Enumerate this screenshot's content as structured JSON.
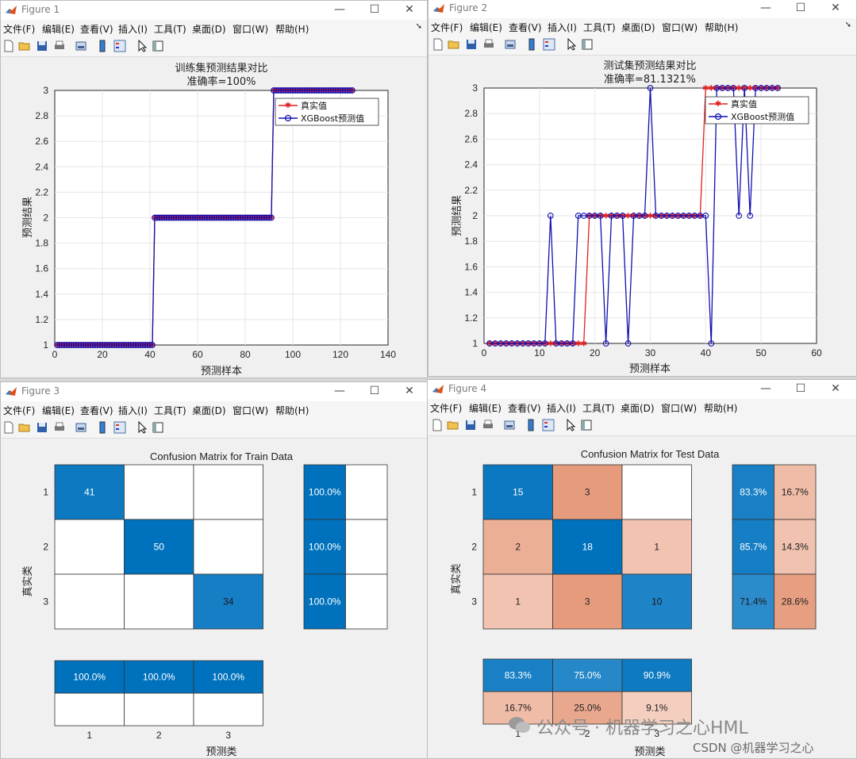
{
  "menu_items": [
    "文件(F)",
    "编辑(E)",
    "查看(V)",
    "插入(I)",
    "工具(T)",
    "桌面(D)",
    "窗口(W)",
    "帮助(H)"
  ],
  "window_controls": {
    "minimize": "—",
    "maximize": "☐",
    "close": "✕"
  },
  "colors": {
    "true_series": "#e02020",
    "pred_series": "#1010b0",
    "dark_blue": "#0072bd",
    "cell_border": "#333333"
  },
  "figures": [
    {
      "title": "Figure 1"
    },
    {
      "title": "Figure 2"
    },
    {
      "title": "Figure 3"
    },
    {
      "title": "Figure 4"
    }
  ],
  "fig1": {
    "title_line1": "训练集预测结果对比",
    "title_line2": "准确率=100%",
    "xlabel": "预测样本",
    "ylabel": "预测结果",
    "legend": [
      "真实值",
      "XGBoost预测值"
    ]
  },
  "fig2": {
    "title_line1": "测试集预测结果对比",
    "title_line2": "准确率=81.1321%",
    "xlabel": "预测样本",
    "ylabel": "预测结果",
    "legend": [
      "真实值",
      "XGBoost预测值"
    ]
  },
  "fig3": {
    "title": "Confusion Matrix for Train Data",
    "xlabel": "预测类",
    "ylabel": "真实类"
  },
  "fig4": {
    "title": "Confusion Matrix for Test Data",
    "xlabel": "预测类",
    "ylabel": "真实类"
  },
  "watermark": {
    "main": "公众号 · 机器学习之心HML",
    "sub": "CSDN @机器学习之心"
  },
  "chart_data": [
    {
      "type": "line",
      "title": "训练集预测结果对比 准确率=100%",
      "xlabel": "预测样本",
      "ylabel": "预测结果",
      "xlim": [
        0,
        140
      ],
      "ylim": [
        1,
        3
      ],
      "xticks": [
        0,
        20,
        40,
        60,
        80,
        100,
        120,
        140
      ],
      "yticks": [
        1,
        1.2,
        1.4,
        1.6,
        1.8,
        2,
        2.2,
        2.4,
        2.6,
        2.8,
        3
      ],
      "grid": true,
      "legend_position": "top-right",
      "series": [
        {
          "name": "真实值",
          "segments": [
            {
              "from": 1,
              "to": 41,
              "value": 1
            },
            {
              "from": 42,
              "to": 91,
              "value": 2
            },
            {
              "from": 92,
              "to": 125,
              "value": 3
            }
          ]
        },
        {
          "name": "XGBoost预测值",
          "segments": [
            {
              "from": 1,
              "to": 41,
              "value": 1
            },
            {
              "from": 42,
              "to": 91,
              "value": 2
            },
            {
              "from": 92,
              "to": 125,
              "value": 3
            }
          ]
        }
      ]
    },
    {
      "type": "line",
      "title": "测试集预测结果对比 准确率=81.1321%",
      "xlabel": "预测样本",
      "ylabel": "预测结果",
      "xlim": [
        0,
        60
      ],
      "ylim": [
        1,
        3
      ],
      "xticks": [
        0,
        10,
        20,
        30,
        40,
        50,
        60
      ],
      "yticks": [
        1,
        1.2,
        1.4,
        1.6,
        1.8,
        2,
        2.2,
        2.4,
        2.6,
        2.8,
        3
      ],
      "grid": true,
      "legend_position": "top-right",
      "x": [
        1,
        2,
        3,
        4,
        5,
        6,
        7,
        8,
        9,
        10,
        11,
        12,
        13,
        14,
        15,
        16,
        17,
        18,
        19,
        20,
        21,
        22,
        23,
        24,
        25,
        26,
        27,
        28,
        29,
        30,
        31,
        32,
        33,
        34,
        35,
        36,
        37,
        38,
        39,
        40,
        41,
        42,
        43,
        44,
        45,
        46,
        47,
        48,
        49,
        50,
        51,
        52,
        53
      ],
      "series": [
        {
          "name": "真实值",
          "values": [
            1,
            1,
            1,
            1,
            1,
            1,
            1,
            1,
            1,
            1,
            1,
            1,
            1,
            1,
            1,
            1,
            1,
            1,
            2,
            2,
            2,
            2,
            2,
            2,
            2,
            2,
            2,
            2,
            2,
            2,
            2,
            2,
            2,
            2,
            2,
            2,
            2,
            2,
            2,
            3,
            3,
            3,
            3,
            3,
            3,
            3,
            3,
            3,
            3,
            3,
            3,
            3,
            3
          ]
        },
        {
          "name": "XGBoost预测值",
          "values": [
            1,
            1,
            1,
            1,
            1,
            1,
            1,
            1,
            1,
            1,
            1,
            2,
            1,
            1,
            1,
            1,
            2,
            2,
            2,
            2,
            2,
            1,
            2,
            2,
            2,
            1,
            2,
            2,
            2,
            3,
            2,
            2,
            2,
            2,
            2,
            2,
            2,
            2,
            2,
            2,
            1,
            3,
            3,
            3,
            3,
            2,
            3,
            2,
            3,
            3,
            3,
            3,
            3
          ]
        }
      ]
    },
    {
      "type": "heatmap",
      "title": "Confusion Matrix for Train Data",
      "xlabel": "预测类",
      "ylabel": "真实类",
      "classes": [
        "1",
        "2",
        "3"
      ],
      "matrix": [
        [
          41,
          null,
          null
        ],
        [
          null,
          50,
          null
        ],
        [
          null,
          null,
          34
        ]
      ],
      "row_summary": [
        [
          "100.0%",
          ""
        ],
        [
          "100.0%",
          ""
        ],
        [
          "100.0%",
          ""
        ]
      ],
      "column_summary": [
        [
          "100.0%",
          "100.0%",
          "100.0%"
        ],
        [
          "",
          "",
          ""
        ]
      ]
    },
    {
      "type": "heatmap",
      "title": "Confusion Matrix for Test Data",
      "xlabel": "预测类",
      "ylabel": "真实类",
      "classes": [
        "1",
        "2",
        "3"
      ],
      "matrix": [
        [
          15,
          3,
          null
        ],
        [
          2,
          18,
          1
        ],
        [
          1,
          3,
          10
        ]
      ],
      "row_summary": [
        [
          "83.3%",
          "16.7%"
        ],
        [
          "85.7%",
          "14.3%"
        ],
        [
          "71.4%",
          "28.6%"
        ]
      ],
      "column_summary": [
        [
          "83.3%",
          "75.0%",
          "90.9%"
        ],
        [
          "16.7%",
          "25.0%",
          "9.1%"
        ]
      ]
    }
  ]
}
